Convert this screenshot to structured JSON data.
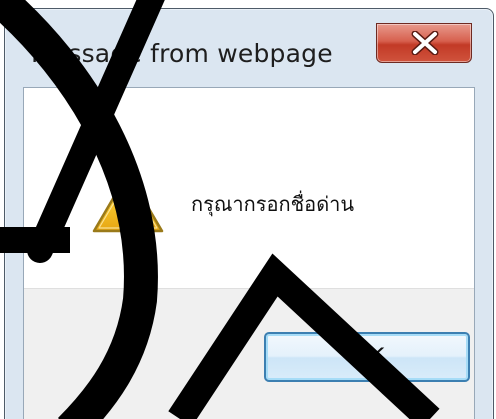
{
  "window": {
    "title": "Message from webpage",
    "close_icon": "close-x-icon"
  },
  "dialog": {
    "icon": "warning-icon",
    "message": "กรุณากรอกชื่อด่าน",
    "ok_label": "OK"
  },
  "colors": {
    "close_button": "#c94631",
    "ok_border": "#3c7fb1",
    "frame": "#dbe6f1",
    "warning_fill": "#f7c62f"
  }
}
